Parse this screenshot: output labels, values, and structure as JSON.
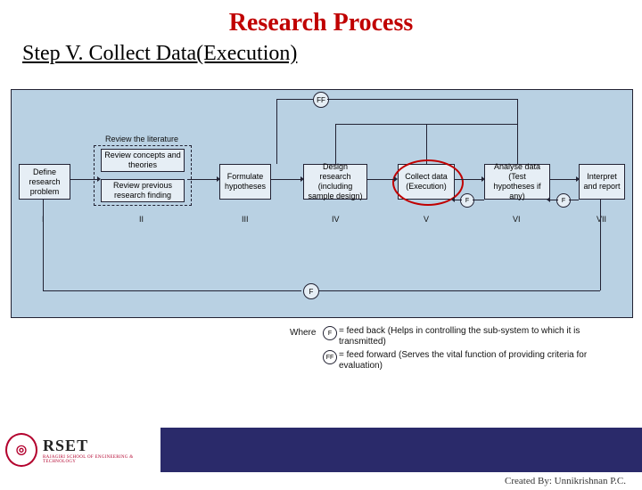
{
  "title": "Research Process",
  "subtitle": "Step V. Collect Data(Execution)",
  "diagram": {
    "review_header": "Review the literature",
    "boxes": {
      "define": "Define research problem",
      "concepts": "Review concepts and theories",
      "previous": "Review previous research finding",
      "formulate": "Formulate hypotheses",
      "design": "Design research (including sample design)",
      "collect": "Collect data (Execution)",
      "analyse": "Analyse data (Test hypotheses if any)",
      "interpret": "Interpret and report"
    },
    "romans": {
      "i": "I",
      "ii": "II",
      "iii": "III",
      "iv": "IV",
      "v": "V",
      "vi": "VI",
      "vii": "VII"
    },
    "f": "F",
    "ff": "FF",
    "legend": {
      "where": "Where",
      "f_def": "= feed back (Helps in controlling the sub-system to which it is transmitted)",
      "ff_def": "= feed forward (Serves the vital function of providing criteria for evaluation)"
    }
  },
  "logo": {
    "abbr": "RSET",
    "sub": "RAJAGIRI SCHOOL OF ENGINEERING & TECHNOLOGY",
    "emblem": "◎"
  },
  "creator": "Created By: Unnikrishnan P.C."
}
